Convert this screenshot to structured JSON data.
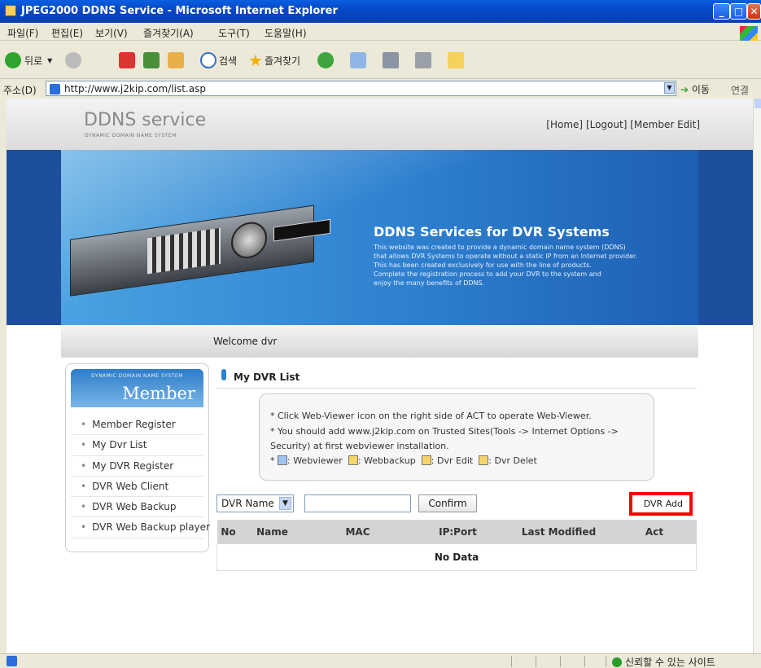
{
  "window": {
    "title": "JPEG2000 DDNS Service - Microsoft Internet Explorer"
  },
  "menubar": [
    "파일(F)",
    "편집(E)",
    "보기(V)",
    "즐겨찾기(A)",
    "도구(T)",
    "도움말(H)"
  ],
  "toolbar": {
    "back": "뒤로",
    "search": "검색",
    "favorites": "즐겨찾기"
  },
  "address": {
    "label": "주소(D)",
    "url": "http://www.j2kip.com/list.asp",
    "go": "이동",
    "links": "연결"
  },
  "site": {
    "logo": "DDNS service",
    "logo_sub": "DYNAMIC DOMAIN NAME SYSTEM",
    "top_links": {
      "home": "[Home]",
      "logout": "[Logout]",
      "member_edit": "[Member Edit]"
    },
    "banner": {
      "title": "DDNS Services for DVR Systems",
      "lines": [
        "This website was created to provide a dynamic domain name system (DDNS)",
        "that allows DVR Systems to operate without a static IP from an Internet provider.",
        "This has been created exclusively for use with the line of products.",
        "Complete the registration process to add your DVR to the system and",
        "enjoy the many benefits of DDNS."
      ]
    },
    "welcome": "Welcome dvr"
  },
  "sidebar": {
    "header_sub": "DYNAMIC DOMAIN NAME SYSTEM",
    "header_title": "Member",
    "items": [
      {
        "label": "Member Register"
      },
      {
        "label": "My Dvr List"
      },
      {
        "label": "My DVR Register"
      },
      {
        "label": "DVR Web Client"
      },
      {
        "label": "DVR Web Backup"
      },
      {
        "label": "DVR Web Backup player"
      }
    ]
  },
  "main": {
    "section_title": "My DVR List",
    "note": {
      "line1": "* Click Web-Viewer icon on the right side of ACT to operate Web-Viewer.",
      "line2": "* You should add www.j2kip.com on Trusted Sites(Tools -> Internet Options ->",
      "line3": "Security) at first webviewer installation.",
      "legend_prefix": "* ",
      "webviewer": ": Webviewer",
      "webbackup": ": Webbackup",
      "edit": ": Dvr Edit",
      "delete": ": Dvr Delet"
    },
    "search": {
      "field_selected": "DVR Name",
      "keyword": "",
      "confirm": "Confirm"
    },
    "dvr_add": "DVR Add",
    "table": {
      "columns": [
        "No",
        "Name",
        "MAC",
        "IP:Port",
        "Last Modified",
        "Act"
      ],
      "empty": "No Data"
    }
  },
  "status": {
    "zone": "신뢰할 수 있는 사이트"
  },
  "colors": {
    "xp_title": "#0a5fe0",
    "banner": "#2e7fcf",
    "highlight": "#ff0000"
  }
}
